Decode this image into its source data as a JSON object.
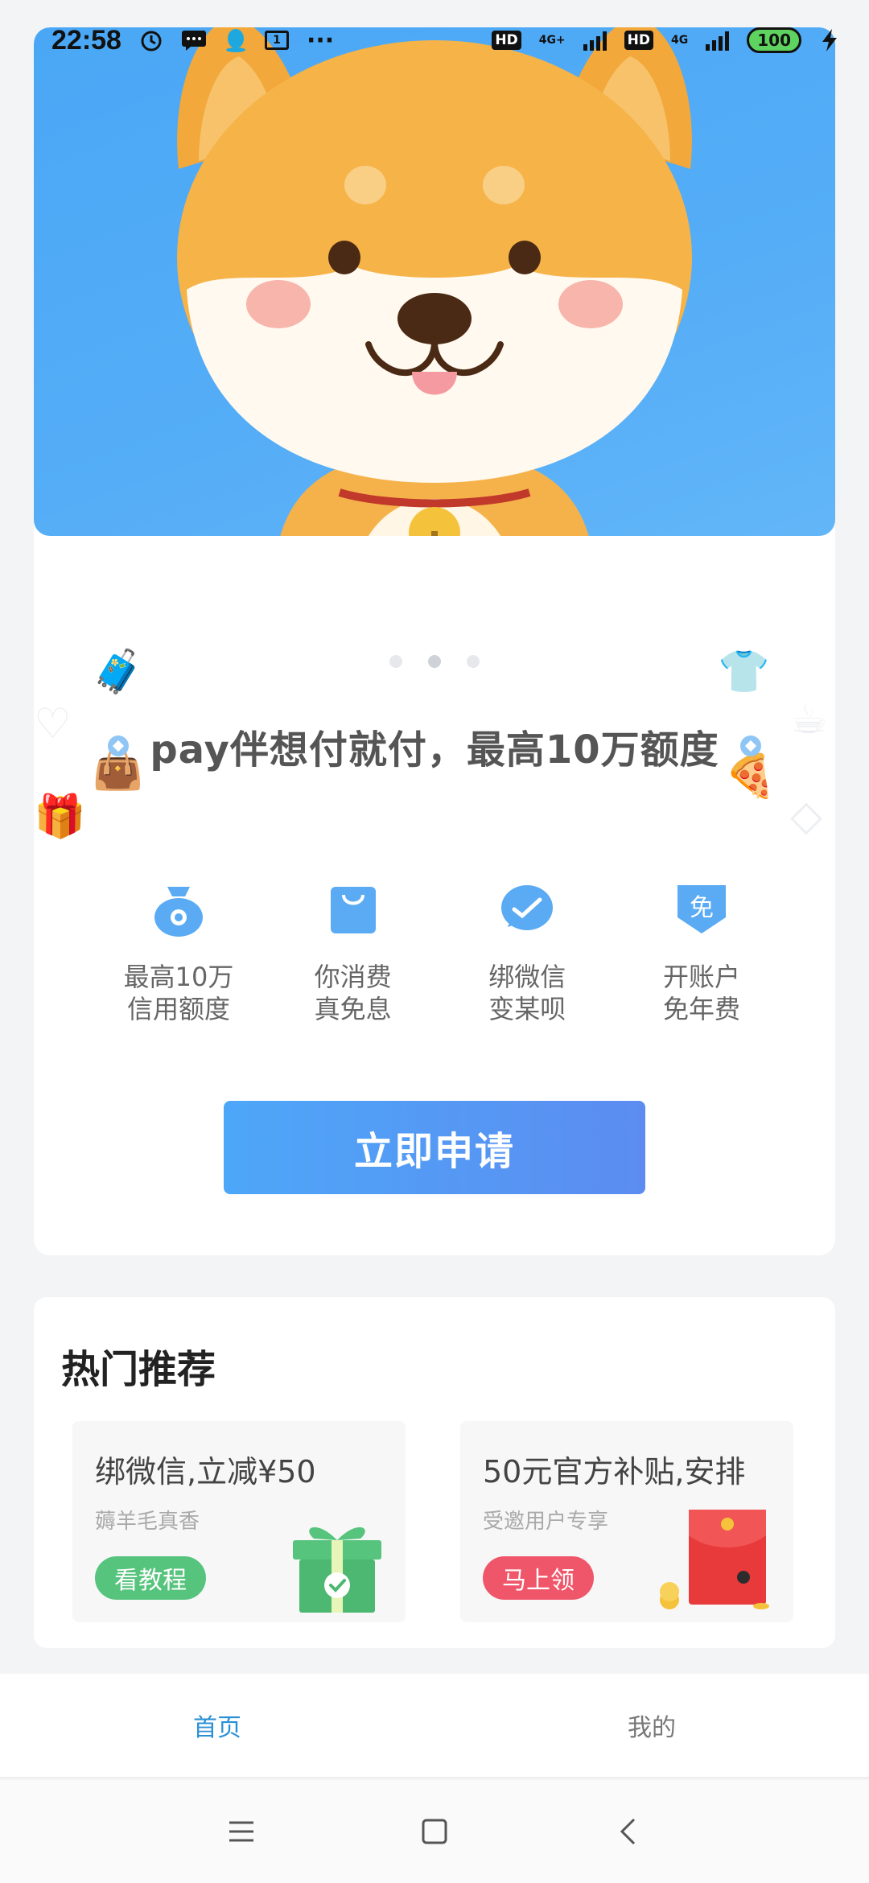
{
  "status_bar": {
    "time": "22:58",
    "net1": "4G+",
    "net2": "4G",
    "hd": "HD",
    "battery": "100",
    "cal": "1"
  },
  "banner": {
    "dots": 3,
    "active_dot": 1
  },
  "tagline": "pay伴想付就付，最高10万额度",
  "features": [
    {
      "icon": "money-bag-icon",
      "line1": "最高10万",
      "line2": "信用额度"
    },
    {
      "icon": "shopping-bag-icon",
      "line1": "你消费",
      "line2": "真免息"
    },
    {
      "icon": "wechat-check-icon",
      "line1": "绑微信",
      "line2": "变某呗"
    },
    {
      "icon": "free-badge-icon",
      "line1": "开账户",
      "line2": "免年费",
      "badge": "免"
    }
  ],
  "apply_button": "立即申请",
  "recommend": {
    "title": "热门推荐",
    "items": [
      {
        "title": "绑微信,立减¥50",
        "subtitle": "薅羊毛真香",
        "button": "看教程"
      },
      {
        "title": "50元官方补贴,安排",
        "subtitle": "受邀用户专享",
        "button": "马上领"
      }
    ]
  },
  "tabs": [
    {
      "label": "首页",
      "active": true
    },
    {
      "label": "我的",
      "active": false
    }
  ],
  "colors": {
    "accent": "#4da7f9",
    "tab_active": "#2a90d6",
    "green_button": "#56c47d",
    "red_button": "#f0566a"
  }
}
